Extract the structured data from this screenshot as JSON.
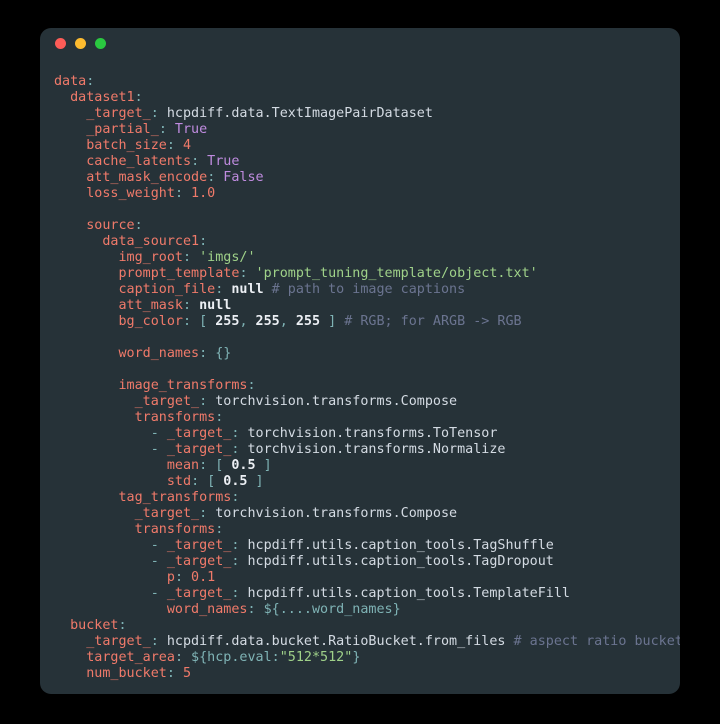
{
  "window": {
    "background_color": "#263238",
    "page_background_color": "#000000",
    "traffic_lights": [
      {
        "name": "close",
        "color": "#fc5c57"
      },
      {
        "name": "minimize",
        "color": "#fcbb2f"
      },
      {
        "name": "maximize",
        "color": "#2ac840"
      }
    ]
  },
  "theme": {
    "key_color": "#f07a6a",
    "string_color": "#9fd189",
    "boolean_color": "#c08ce0",
    "comment_color": "#6b7490",
    "plain_color": "#d4dbe3",
    "punctuation_color": "#7fb3b5",
    "number_bold_color": "#eceff4"
  },
  "code": {
    "language": "yaml",
    "lines": [
      {
        "indent": 0,
        "tokens": [
          {
            "t": "key",
            "v": "data"
          },
          {
            "t": "punct",
            "v": ":"
          }
        ]
      },
      {
        "indent": 2,
        "tokens": [
          {
            "t": "key",
            "v": "dataset1"
          },
          {
            "t": "punct",
            "v": ":"
          }
        ]
      },
      {
        "indent": 4,
        "tokens": [
          {
            "t": "key",
            "v": "_target_"
          },
          {
            "t": "punct",
            "v": ":"
          },
          {
            "t": "plain",
            "v": " hcpdiff.data.TextImagePairDataset"
          }
        ]
      },
      {
        "indent": 4,
        "tokens": [
          {
            "t": "key",
            "v": "_partial_"
          },
          {
            "t": "punct",
            "v": ":"
          },
          {
            "t": "bool",
            "v": " True"
          }
        ]
      },
      {
        "indent": 4,
        "tokens": [
          {
            "t": "key",
            "v": "batch_size"
          },
          {
            "t": "punct",
            "v": ":"
          },
          {
            "t": "num",
            "v": " 4"
          }
        ]
      },
      {
        "indent": 4,
        "tokens": [
          {
            "t": "key",
            "v": "cache_latents"
          },
          {
            "t": "punct",
            "v": ":"
          },
          {
            "t": "bool",
            "v": " True"
          }
        ]
      },
      {
        "indent": 4,
        "tokens": [
          {
            "t": "key",
            "v": "att_mask_encode"
          },
          {
            "t": "punct",
            "v": ":"
          },
          {
            "t": "bool",
            "v": " False"
          }
        ]
      },
      {
        "indent": 4,
        "tokens": [
          {
            "t": "key",
            "v": "loss_weight"
          },
          {
            "t": "punct",
            "v": ":"
          },
          {
            "t": "num",
            "v": " 1.0"
          }
        ]
      },
      {
        "indent": 0,
        "tokens": []
      },
      {
        "indent": 4,
        "tokens": [
          {
            "t": "key",
            "v": "source"
          },
          {
            "t": "punct",
            "v": ":"
          }
        ]
      },
      {
        "indent": 6,
        "tokens": [
          {
            "t": "key",
            "v": "data_source1"
          },
          {
            "t": "punct",
            "v": ":"
          }
        ]
      },
      {
        "indent": 8,
        "tokens": [
          {
            "t": "key",
            "v": "img_root"
          },
          {
            "t": "punct",
            "v": ":"
          },
          {
            "t": "str",
            "v": " 'imgs/'"
          }
        ]
      },
      {
        "indent": 8,
        "tokens": [
          {
            "t": "key",
            "v": "prompt_template"
          },
          {
            "t": "punct",
            "v": ":"
          },
          {
            "t": "str",
            "v": " 'prompt_tuning_template/object.txt'"
          }
        ]
      },
      {
        "indent": 8,
        "tokens": [
          {
            "t": "key",
            "v": "caption_file"
          },
          {
            "t": "punct",
            "v": ":"
          },
          {
            "t": "null",
            "v": " null"
          },
          {
            "t": "comment",
            "v": " # path to image captions"
          }
        ]
      },
      {
        "indent": 8,
        "tokens": [
          {
            "t": "key",
            "v": "att_mask"
          },
          {
            "t": "punct",
            "v": ":"
          },
          {
            "t": "null",
            "v": " null"
          }
        ]
      },
      {
        "indent": 8,
        "tokens": [
          {
            "t": "key",
            "v": "bg_color"
          },
          {
            "t": "punct",
            "v": ":"
          },
          {
            "t": "bracket",
            "v": " ["
          },
          {
            "t": "numb",
            "v": " 255"
          },
          {
            "t": "bracket",
            "v": ","
          },
          {
            "t": "numb",
            "v": " 255"
          },
          {
            "t": "bracket",
            "v": ","
          },
          {
            "t": "numb",
            "v": " 255"
          },
          {
            "t": "bracket",
            "v": " ]"
          },
          {
            "t": "comment",
            "v": " # RGB; for ARGB -> RGB"
          }
        ]
      },
      {
        "indent": 0,
        "tokens": []
      },
      {
        "indent": 8,
        "tokens": [
          {
            "t": "key",
            "v": "word_names"
          },
          {
            "t": "punct",
            "v": ":"
          },
          {
            "t": "bracket",
            "v": " {}"
          }
        ]
      },
      {
        "indent": 0,
        "tokens": []
      },
      {
        "indent": 8,
        "tokens": [
          {
            "t": "key",
            "v": "image_transforms"
          },
          {
            "t": "punct",
            "v": ":"
          }
        ]
      },
      {
        "indent": 10,
        "tokens": [
          {
            "t": "key",
            "v": "_target_"
          },
          {
            "t": "punct",
            "v": ":"
          },
          {
            "t": "plain",
            "v": " torchvision.transforms.Compose"
          }
        ]
      },
      {
        "indent": 10,
        "tokens": [
          {
            "t": "key",
            "v": "transforms"
          },
          {
            "t": "punct",
            "v": ":"
          }
        ]
      },
      {
        "indent": 12,
        "tokens": [
          {
            "t": "dash",
            "v": "- "
          },
          {
            "t": "key",
            "v": "_target_"
          },
          {
            "t": "punct",
            "v": ":"
          },
          {
            "t": "plain",
            "v": " torchvision.transforms.ToTensor"
          }
        ]
      },
      {
        "indent": 12,
        "tokens": [
          {
            "t": "dash",
            "v": "- "
          },
          {
            "t": "key",
            "v": "_target_"
          },
          {
            "t": "punct",
            "v": ":"
          },
          {
            "t": "plain",
            "v": " torchvision.transforms.Normalize"
          }
        ]
      },
      {
        "indent": 14,
        "tokens": [
          {
            "t": "key",
            "v": "mean"
          },
          {
            "t": "punct",
            "v": ":"
          },
          {
            "t": "bracket",
            "v": " ["
          },
          {
            "t": "numb",
            "v": " 0.5"
          },
          {
            "t": "bracket",
            "v": " ]"
          }
        ]
      },
      {
        "indent": 14,
        "tokens": [
          {
            "t": "key",
            "v": "std"
          },
          {
            "t": "punct",
            "v": ":"
          },
          {
            "t": "bracket",
            "v": " ["
          },
          {
            "t": "numb",
            "v": " 0.5"
          },
          {
            "t": "bracket",
            "v": " ]"
          }
        ]
      },
      {
        "indent": 8,
        "tokens": [
          {
            "t": "key",
            "v": "tag_transforms"
          },
          {
            "t": "punct",
            "v": ":"
          }
        ]
      },
      {
        "indent": 10,
        "tokens": [
          {
            "t": "key",
            "v": "_target_"
          },
          {
            "t": "punct",
            "v": ":"
          },
          {
            "t": "plain",
            "v": " torchvision.transforms.Compose"
          }
        ]
      },
      {
        "indent": 10,
        "tokens": [
          {
            "t": "key",
            "v": "transforms"
          },
          {
            "t": "punct",
            "v": ":"
          }
        ]
      },
      {
        "indent": 12,
        "tokens": [
          {
            "t": "dash",
            "v": "- "
          },
          {
            "t": "key",
            "v": "_target_"
          },
          {
            "t": "punct",
            "v": ":"
          },
          {
            "t": "plain",
            "v": " hcpdiff.utils.caption_tools.TagShuffle"
          }
        ]
      },
      {
        "indent": 12,
        "tokens": [
          {
            "t": "dash",
            "v": "- "
          },
          {
            "t": "key",
            "v": "_target_"
          },
          {
            "t": "punct",
            "v": ":"
          },
          {
            "t": "plain",
            "v": " hcpdiff.utils.caption_tools.TagDropout"
          }
        ]
      },
      {
        "indent": 14,
        "tokens": [
          {
            "t": "key",
            "v": "p"
          },
          {
            "t": "punct",
            "v": ":"
          },
          {
            "t": "num",
            "v": " 0.1"
          }
        ]
      },
      {
        "indent": 12,
        "tokens": [
          {
            "t": "dash",
            "v": "- "
          },
          {
            "t": "key",
            "v": "_target_"
          },
          {
            "t": "punct",
            "v": ":"
          },
          {
            "t": "plain",
            "v": " hcpdiff.utils.caption_tools.TemplateFill"
          }
        ]
      },
      {
        "indent": 14,
        "tokens": [
          {
            "t": "key",
            "v": "word_names"
          },
          {
            "t": "punct",
            "v": ":"
          },
          {
            "t": "interp",
            "v": " ${....word_names}"
          }
        ]
      },
      {
        "indent": 2,
        "tokens": [
          {
            "t": "key",
            "v": "bucket"
          },
          {
            "t": "punct",
            "v": ":"
          }
        ]
      },
      {
        "indent": 4,
        "tokens": [
          {
            "t": "key",
            "v": "_target_"
          },
          {
            "t": "punct",
            "v": ":"
          },
          {
            "t": "plain",
            "v": " hcpdiff.data.bucket.RatioBucket.from_files"
          },
          {
            "t": "comment",
            "v": " # aspect ratio bucket"
          }
        ]
      },
      {
        "indent": 4,
        "tokens": [
          {
            "t": "key",
            "v": "target_area"
          },
          {
            "t": "punct",
            "v": ":"
          },
          {
            "t": "interp",
            "v": " ${hcp.eval:"
          },
          {
            "t": "str",
            "v": "\"512*512\""
          },
          {
            "t": "interp",
            "v": "}"
          }
        ]
      },
      {
        "indent": 4,
        "tokens": [
          {
            "t": "key",
            "v": "num_bucket"
          },
          {
            "t": "punct",
            "v": ":"
          },
          {
            "t": "num",
            "v": " 5"
          }
        ]
      }
    ]
  }
}
